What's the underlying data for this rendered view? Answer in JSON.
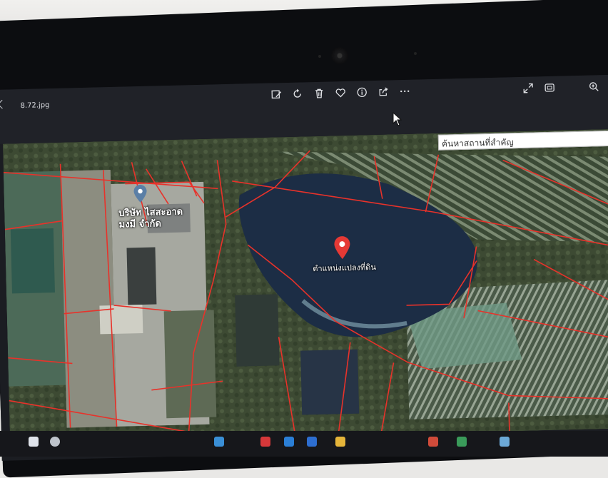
{
  "viewer": {
    "filename": "8.72.jpg"
  },
  "toolbar": {
    "tools": [
      {
        "icon": "edit-image-icon"
      },
      {
        "icon": "rotate-icon"
      },
      {
        "icon": "delete-icon"
      },
      {
        "icon": "favorite-heart-icon"
      },
      {
        "icon": "info-icon"
      },
      {
        "icon": "share-icon"
      },
      {
        "icon": "more-options-icon"
      }
    ],
    "right_icons": [
      "expand-icon",
      "fit-screen-icon",
      "zoom-in-icon"
    ]
  },
  "map": {
    "search_placeholder": "ค้นหาสถานที่สำคัญ",
    "main_pin_label": "ตำแหน่งแปลงที่ดิน",
    "company_label_line1": "บริษัท ไสสะอาด",
    "company_label_line2": "มงมี จำกัด",
    "pin_color": "#e53935",
    "boundary_color": "#e8322a"
  }
}
